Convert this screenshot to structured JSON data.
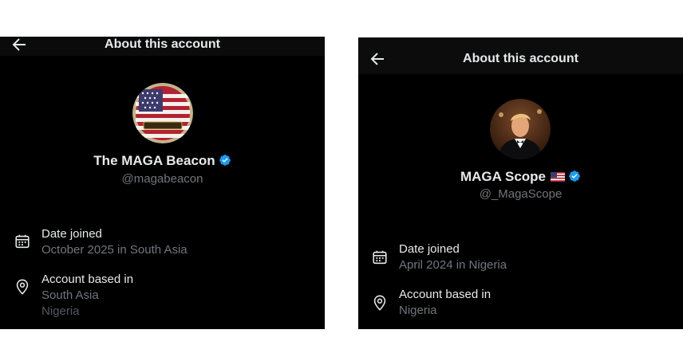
{
  "left": {
    "header": {
      "title": "About this account"
    },
    "profile": {
      "name": "The MAGA Beacon",
      "handle": "@magabeacon",
      "avatar_banner": "The MAGA Beacon"
    },
    "date_joined": {
      "label": "Date joined",
      "value": "October 2025 in South Asia"
    },
    "account_based": {
      "label": "Account based in",
      "value": "South Asia",
      "value_cut": "Nigeria"
    }
  },
  "right": {
    "header": {
      "title": "About this account"
    },
    "profile": {
      "name": "MAGA Scope",
      "handle": "@_MagaScope",
      "flag_icon": "us-flag-icon"
    },
    "date_joined": {
      "label": "Date joined",
      "value": "April 2024 in Nigeria"
    },
    "account_based": {
      "label": "Account based in",
      "value": "Nigeria"
    }
  },
  "colors": {
    "background": "#000000",
    "text_primary": "#e7e9ea",
    "text_secondary": "#71767b",
    "verified": "#1d9bf0"
  }
}
